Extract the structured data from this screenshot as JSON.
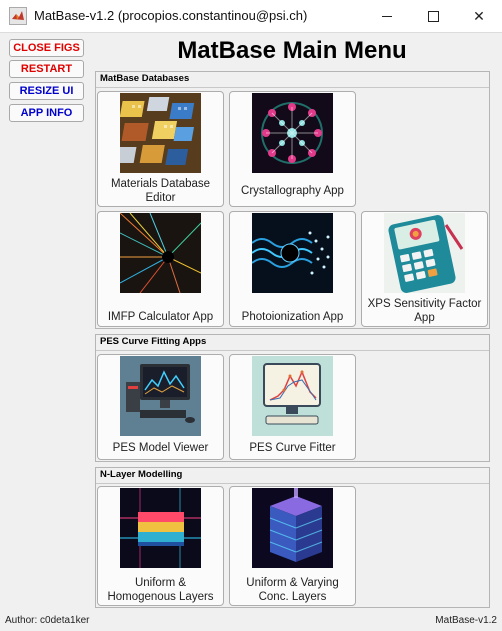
{
  "window": {
    "title": "MatBase-v1.2 (procopios.constantinou@psi.ch)",
    "minimize_icon": "minimize-icon",
    "maximize_icon": "maximize-icon",
    "close_icon": "close-icon",
    "close_glyph": "✕"
  },
  "sidebar": {
    "close_figs": "CLOSE FIGS",
    "restart": "RESTART",
    "resize_ui": "RESIZE UI",
    "app_info": "APP INFO",
    "colors": {
      "red": "#e00000",
      "blue": "#0000cc"
    }
  },
  "main": {
    "title": "MatBase Main Menu"
  },
  "panels": {
    "databases": {
      "title": "MatBase Databases",
      "apps": [
        {
          "label": "Materials Database Editor",
          "icon": "materials-database-icon"
        },
        {
          "label": "Crystallography App",
          "icon": "crystal-lattice-icon"
        },
        {
          "label": "IMFP Calculator App",
          "icon": "electron-scatter-icon"
        },
        {
          "label": "Photoionization App",
          "icon": "photoionization-icon"
        },
        {
          "label": "XPS Sensitivity Factor App",
          "icon": "calculator-icon"
        }
      ]
    },
    "pes": {
      "title": "PES Curve Fitting Apps",
      "apps": [
        {
          "label": "PES Model Viewer",
          "icon": "computer-monitor-icon"
        },
        {
          "label": "PES Curve Fitter",
          "icon": "curve-fit-monitor-icon"
        }
      ]
    },
    "nlayer": {
      "title": "N-Layer Modelling",
      "apps": [
        {
          "label": "Uniform & Homogenous Layers",
          "icon": "layered-slab-icon"
        },
        {
          "label": "Uniform & Varying Conc. Layers",
          "icon": "layered-cube-icon"
        }
      ]
    }
  },
  "footer": {
    "author": "Author: c0deta1ker",
    "version": "MatBase-v1.2"
  }
}
